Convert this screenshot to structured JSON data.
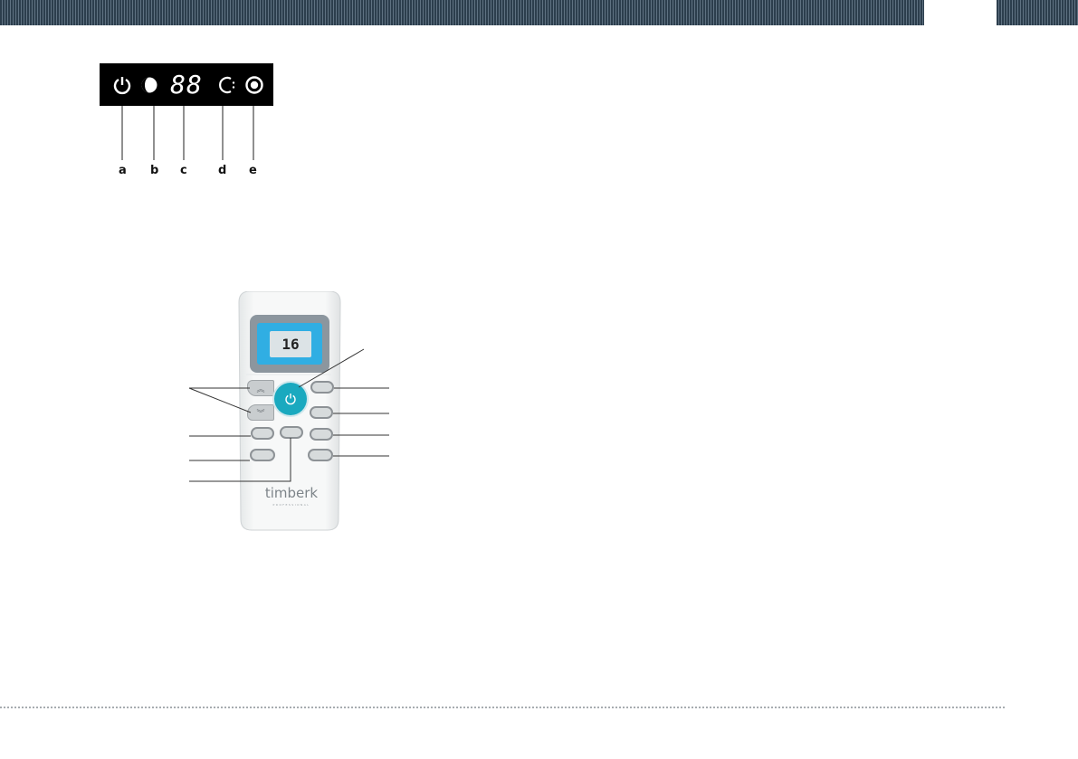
{
  "panel": {
    "display_value": "88",
    "labels": [
      "a",
      "b",
      "c",
      "d",
      "e"
    ],
    "icons": [
      "power-icon",
      "night-mode-icon",
      "digital-display",
      "timer-icon",
      "mode-icon"
    ]
  },
  "remote": {
    "lcd_value": "16",
    "brand": "timberk",
    "brand_subtitle": "PROFESSIONAL",
    "colors": {
      "power": "#1aa9bf",
      "lcd": "#30aee3",
      "panel": "#000000",
      "header": "#2c3e4d"
    }
  }
}
